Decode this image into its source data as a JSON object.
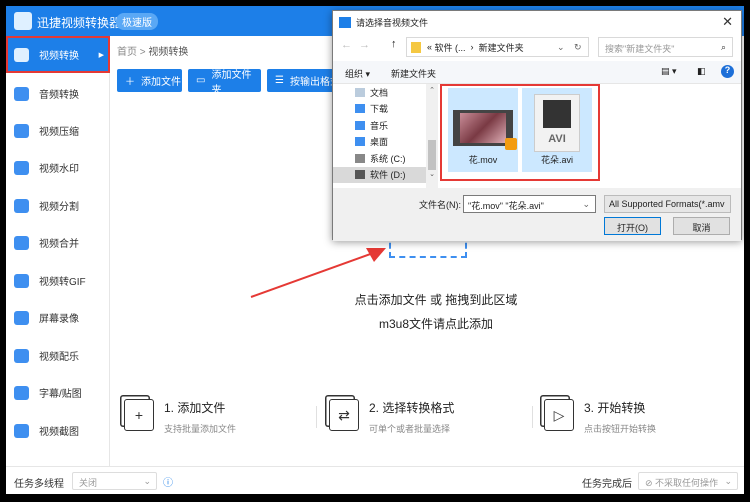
{
  "app": {
    "title": "迅捷视频转换器",
    "edition": "极速版"
  },
  "sidebar": {
    "items": [
      {
        "label": "视频转换",
        "icon": "video-convert-icon"
      },
      {
        "label": "音频转换",
        "icon": "audio-convert-icon"
      },
      {
        "label": "视频压缩",
        "icon": "compress-icon"
      },
      {
        "label": "视频水印",
        "icon": "watermark-icon"
      },
      {
        "label": "视频分割",
        "icon": "split-icon"
      },
      {
        "label": "视频合并",
        "icon": "merge-icon"
      },
      {
        "label": "视频转GIF",
        "icon": "gif-icon"
      },
      {
        "label": "屏幕录像",
        "icon": "record-icon"
      },
      {
        "label": "视频配乐",
        "icon": "music-icon"
      },
      {
        "label": "字幕/贴图",
        "icon": "subtitle-icon"
      },
      {
        "label": "视频截图",
        "icon": "screenshot-icon"
      }
    ]
  },
  "breadcrumb": {
    "home": "首页",
    "sep": ">",
    "current": "视频转换"
  },
  "toolbar": {
    "add_file": "添加文件",
    "add_folder": "添加文件夹",
    "by_format": "按输出格式"
  },
  "dropzone": {
    "line1": "点击添加文件 或 拖拽到此区域",
    "line2": "m3u8文件请点此添加"
  },
  "steps": [
    {
      "title": "1. 添加文件",
      "sub": "支持批量添加文件"
    },
    {
      "title": "2. 选择转换格式",
      "sub": "可单个或者批量选择"
    },
    {
      "title": "3. 开始转换",
      "sub": "点击按钮开始转换"
    }
  ],
  "footer": {
    "multitask_label": "任务多线程",
    "multitask_value": "关闭",
    "after_label": "任务完成后",
    "after_value": "不采取任何操作"
  },
  "dialog": {
    "title": "请选择音视频文件",
    "address": [
      "«",
      "软件 (...",
      "›",
      "新建文件夹"
    ],
    "search_placeholder": "搜索\"新建文件夹\"",
    "organize": "组织 ▾",
    "new_folder": "新建文件夹",
    "nav": [
      "文档",
      "下载",
      "音乐",
      "桌面",
      "系统 (C:)",
      "软件 (D:)"
    ],
    "files": [
      {
        "name": "花.mov"
      },
      {
        "name": "花朵.avi",
        "badge": "AVI"
      }
    ],
    "filename_label": "文件名(N):",
    "filename_value": "\"花.mov\" \"花朵.avi\"",
    "filetype": "All Supported Formats(*.amv",
    "open": "打开(O)",
    "cancel": "取消"
  },
  "colors": {
    "accent": "#1d7fe8",
    "highlight": "#e53935"
  }
}
